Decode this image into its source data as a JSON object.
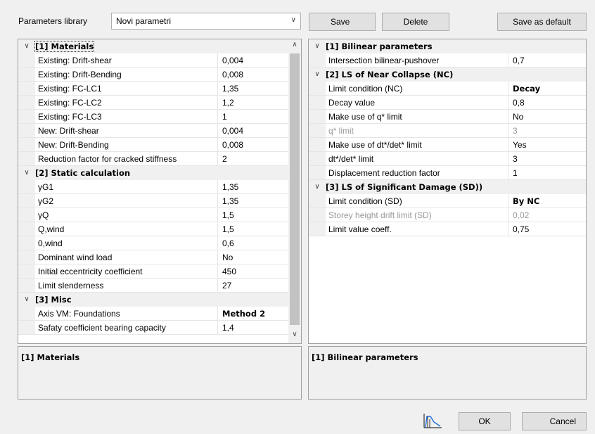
{
  "toolbar": {
    "library_label": "Parameters library",
    "library_value": "Novi parametri",
    "save_label": "Save",
    "delete_label": "Delete",
    "save_default_label": "Save as default"
  },
  "left_grid": {
    "sections": [
      {
        "title": "[1] Materials",
        "rows": [
          {
            "name": "Existing: Drift-shear",
            "value": "0,004"
          },
          {
            "name": "Existing: Drift-Bending",
            "value": "0,008"
          },
          {
            "name": "Existing: FC-LC1",
            "value": "1,35"
          },
          {
            "name": "Existing: FC-LC2",
            "value": "1,2"
          },
          {
            "name": "Existing: FC-LC3",
            "value": "1"
          },
          {
            "name": "New: Drift-shear",
            "value": "0,004"
          },
          {
            "name": "New: Drift-Bending",
            "value": "0,008"
          },
          {
            "name": "Reduction factor for cracked stiffness",
            "value": "2"
          }
        ]
      },
      {
        "title": "[2] Static calculation",
        "rows": [
          {
            "name": "γG1",
            "value": "1,35"
          },
          {
            "name": "γG2",
            "value": "1,35"
          },
          {
            "name": "γQ",
            "value": "1,5"
          },
          {
            "name": "Q,wind",
            "value": "1,5"
          },
          {
            "name": "0,wind",
            "value": "0,6"
          },
          {
            "name": "Dominant wind load",
            "value": "No"
          },
          {
            "name": "Initial eccentricity coefficient",
            "value": "450"
          },
          {
            "name": "Limit slenderness",
            "value": "27"
          }
        ]
      },
      {
        "title": "[3] Misc",
        "rows": [
          {
            "name": "Axis VM: Foundations",
            "value": "Method 2"
          },
          {
            "name": "Safaty coefficient bearing capacity",
            "value": "1,4"
          }
        ]
      }
    ],
    "description": "[1] Materials"
  },
  "right_grid": {
    "sections": [
      {
        "title": "[1] Bilinear parameters",
        "rows": [
          {
            "name": "Intersection bilinear-pushover",
            "value": "0,7"
          }
        ]
      },
      {
        "title": "[2] LS of Near Collapse (NC)",
        "rows": [
          {
            "name": "Limit condition (NC)",
            "value": "Decay"
          },
          {
            "name": "Decay value",
            "value": "0,8"
          },
          {
            "name": "Make use of q* limit",
            "value": "No"
          },
          {
            "name": "q* limit",
            "value": "3"
          },
          {
            "name": "Make use of dt*/det* limit",
            "value": "Yes"
          },
          {
            "name": "dt*/det* limit",
            "value": "3"
          },
          {
            "name": "Displacement reduction factor",
            "value": "1"
          }
        ]
      },
      {
        "title": "[3] LS of Significant Damage (SD))",
        "rows": [
          {
            "name": "Limit condition (SD)",
            "value": "By NC"
          },
          {
            "name": "Storey height drift limit (SD)",
            "value": "0,02"
          },
          {
            "name": "Limit value coeff.",
            "value": "0,75"
          }
        ]
      }
    ],
    "description": "[1] Bilinear parameters"
  },
  "footer": {
    "ok_label": "OK",
    "cancel_label": "Cancel",
    "chart_icon": "pushover-curve-icon"
  }
}
